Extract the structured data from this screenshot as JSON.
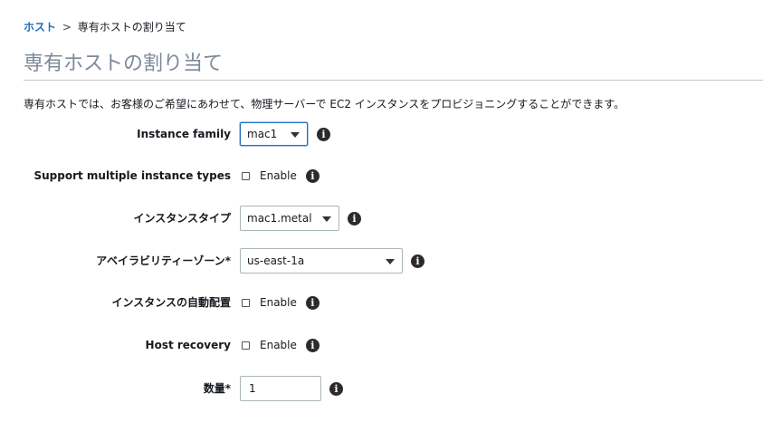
{
  "breadcrumb": {
    "root": "ホスト",
    "separator": ">",
    "current": "専有ホストの割り当て"
  },
  "page": {
    "title": "専有ホストの割り当て",
    "description": "専有ホストでは、お客様のご希望にあわせて、物理サーバーで EC2 インスタンスをプロビジョニングすることができます。"
  },
  "form": {
    "instance_family": {
      "label": "Instance family",
      "value": "mac1"
    },
    "support_multiple_types": {
      "label": "Support multiple instance types",
      "checkbox_label": "Enable",
      "checked": false
    },
    "instance_type": {
      "label": "インスタンスタイプ",
      "value": "mac1.metal"
    },
    "availability_zone": {
      "label": "アベイラビリティーゾーン*",
      "value": "us-east-1a"
    },
    "auto_placement": {
      "label": "インスタンスの自動配置",
      "checkbox_label": "Enable",
      "checked": false
    },
    "host_recovery": {
      "label": "Host recovery",
      "checkbox_label": "Enable",
      "checked": false
    },
    "quantity": {
      "label": "数量*",
      "value": "1"
    }
  },
  "icons": {
    "info": "info-icon",
    "dropdown": "chevron-down-icon"
  },
  "colors": {
    "link": "#1f6ebc",
    "title": "#7d8998",
    "focus_border": "#1f6ebc",
    "info_icon_bg": "#2b2b2b"
  }
}
